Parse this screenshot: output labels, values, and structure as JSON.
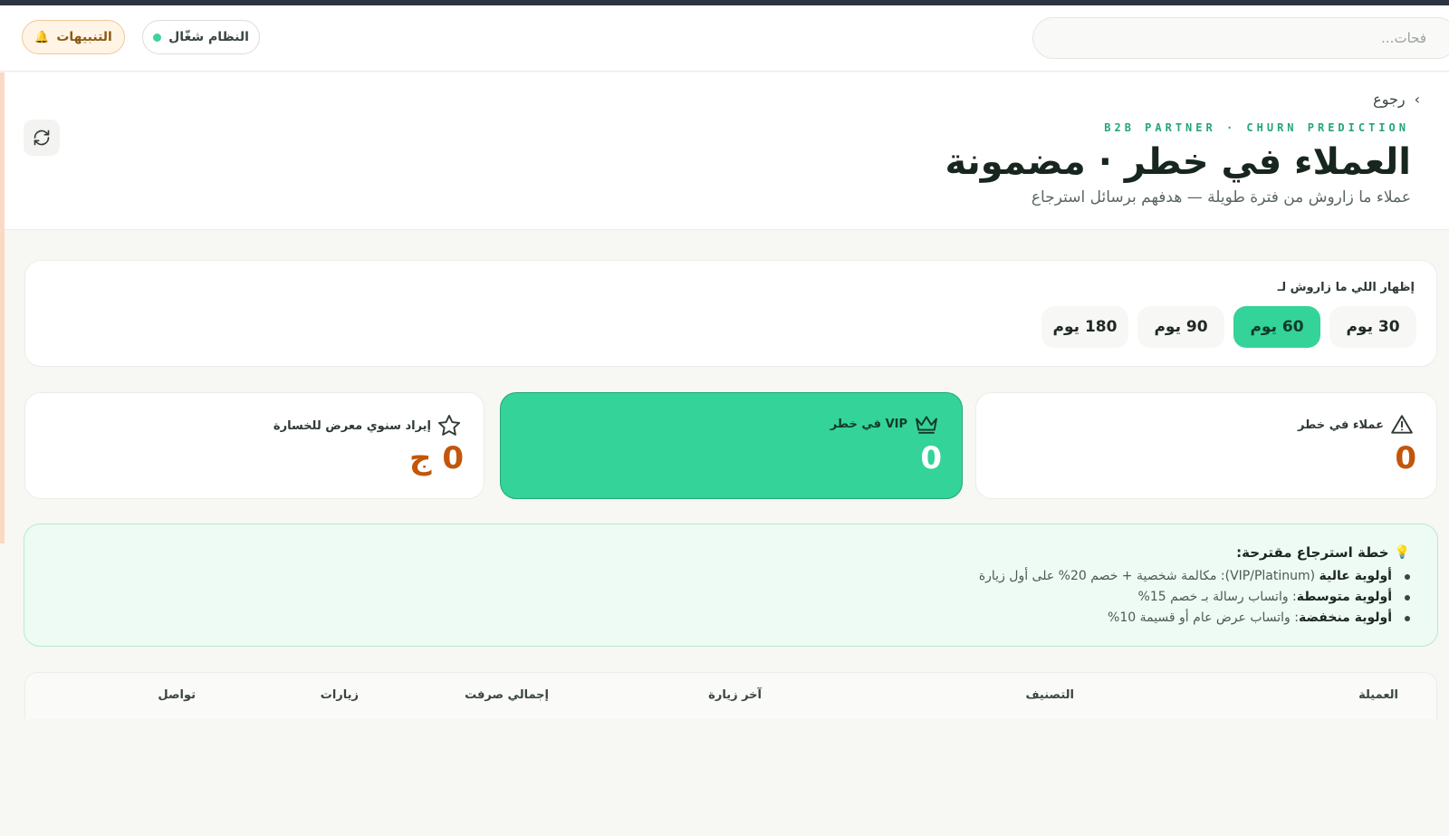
{
  "topbar": {
    "search_placeholder": "فحات...",
    "status_label": "النظام شغّال",
    "alerts_label": "التنبيهات"
  },
  "hero": {
    "back_label": "رجوع",
    "eyebrow": "B2B PARTNER · CHURN PREDICTION",
    "title": "العملاء في خطر · مضمونة",
    "subtitle": "عملاء ما زاروش من فترة طويلة — هدفهم برسائل استرجاع"
  },
  "filter": {
    "label": "إظهار اللي ما زاروش لـ",
    "options": [
      "30 يوم",
      "60 يوم",
      "90 يوم",
      "180 يوم"
    ],
    "selected": "60 يوم"
  },
  "stats": [
    {
      "label": "عملاء في خطر",
      "value": "0",
      "icon": "warning-icon"
    },
    {
      "label": "VIP في خطر",
      "value": "0",
      "icon": "crown-icon"
    },
    {
      "label": "إيراد سنوي معرض للخسارة",
      "value": "0 ج",
      "icon": "star-icon"
    }
  ],
  "plan": {
    "title": "خطة استرجاع مقترحة:",
    "items": [
      {
        "strong": "أولوية عالية",
        "text": " (VIP/Platinum): مكالمة شخصية + خصم 20% على أول زيارة"
      },
      {
        "strong": "أولوية متوسطة",
        "text": ": واتساب رسالة بـ خصم 15%"
      },
      {
        "strong": "أولوية منخفضة",
        "text": ": واتساب عرض عام أو قسيمة 10%"
      }
    ]
  },
  "table": {
    "columns": [
      "العميلة",
      "التصنيف",
      "آخر زيارة",
      "إجمالي صرفت",
      "زيارات",
      "تواصل"
    ]
  },
  "colors": {
    "accent": "#34d399",
    "value_orange": "#c2560a",
    "eyebrow_green": "#22a67a"
  }
}
